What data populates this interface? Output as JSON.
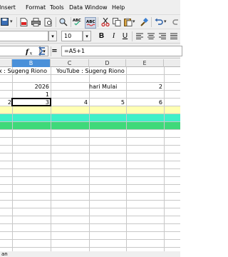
{
  "menu": [
    "Insert",
    "Format",
    "Tools",
    "Data",
    "Window",
    "Help"
  ],
  "toolbar": {
    "font_size": "10"
  },
  "formula_bar": {
    "formula": "=A5+1",
    "icons": [
      "function-wizard-icon",
      "sum-icon",
      "equals-icon"
    ]
  },
  "columns": [
    "B",
    "C",
    "D",
    "E"
  ],
  "cells": {
    "r1_a": "x : Sugeng Riono",
    "r1_c": "YouTube : Sugeng Riono",
    "r3_b": "2026",
    "r3_d": "hari Mulai",
    "r3_e": "2",
    "r4_b": "1",
    "r5_a": "2",
    "r5_b": "3",
    "r5_c": "4",
    "r5_d": "5",
    "r5_e": "6"
  },
  "colors": {
    "yellow_row": "#ffffb3",
    "cyan_row": "#3ff0c8",
    "green_row": "#3fd97a",
    "selected_header": "#4a90d9"
  },
  "status": "an"
}
